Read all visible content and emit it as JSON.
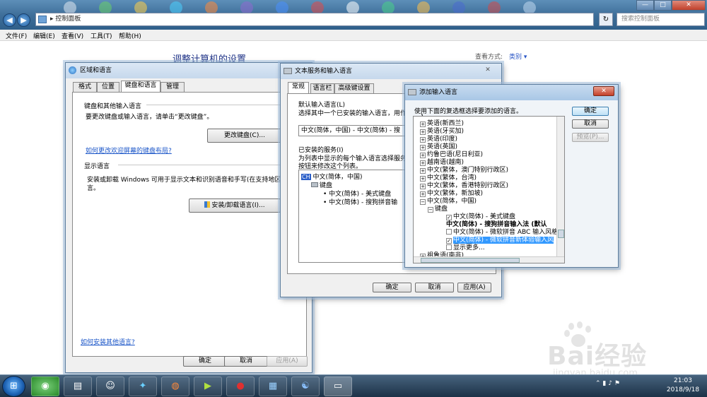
{
  "window": {
    "address": "控制面板",
    "address_sep": "▸",
    "search_placeholder": "搜索控制面板",
    "nav_back": "◀",
    "nav_forward": "▶",
    "refresh": "↻",
    "minimize": "—",
    "maximize": "□",
    "close": "✕"
  },
  "menu": {
    "file": "文件(F)",
    "edit": "编辑(E)",
    "view": "查看(V)",
    "tools": "工具(T)",
    "help": "帮助(H)"
  },
  "controlpanel": {
    "title": "调整计算机的设置",
    "view_by_label": "查看方式:",
    "view_by_value": "类别 ▾"
  },
  "region_dialog": {
    "title": "区域和语言",
    "tabs": [
      "格式",
      "位置",
      "键盘和语言",
      "管理"
    ],
    "kb_group": "键盘和其他输入语言",
    "kb_desc": "要更改键盘或输入语言，请单击“更改键盘”。",
    "change_kb_btn": "更改键盘(C)...",
    "kb_link": "如何更改欢迎屏幕的键盘布局?",
    "display_group": "显示语言",
    "display_desc_1": "安装或卸载 Windows 可用于显示文本和识别语音和手写(在支持地区)的语",
    "display_desc_2": "言。",
    "install_btn": "安装/卸载语言(I)...",
    "more_link": "如何安装其他语言?",
    "ok": "确定",
    "cancel": "取消",
    "apply": "应用(A)"
  },
  "text_services_dialog": {
    "title": "文本服务和输入语言",
    "close": "✕",
    "tabs": [
      "常规",
      "语言栏",
      "高级键设置"
    ],
    "default_group": "默认输入语言(L)",
    "default_desc": "选择其中一个已安装的输入语言，用作",
    "default_value": "中文(简体，中国) - 中文(简体) - 搜",
    "installed_group": "已安装的服务(I)",
    "installed_desc_1": "为列表中显示的每个输入语言选择服务",
    "installed_desc_2": "按钮来修改这个列表。",
    "tree": {
      "lang_code": "CH",
      "lang": "中文(简体，中国)",
      "keyboard": "键盘",
      "item1": "• 中文(简体) - 美式键盘",
      "item2": "• 中文(简体) - 搜狗拼音输"
    },
    "ok": "确定",
    "cancel": "取消",
    "apply": "应用(A)"
  },
  "add_lang_dialog": {
    "title": "添加输入语言",
    "close": "✕",
    "instruction": "使用下面的复选框选择要添加的语言。",
    "ok": "确定",
    "cancel": "取消",
    "preview": "预览(P)...",
    "languages": [
      "英语(新西兰)",
      "英语(牙买加)",
      "英语(印度)",
      "英语(英国)",
      "约鲁巴语(尼日利亚)",
      "越南语(越南)",
      "中文(繁体，澳门特别行政区)",
      "中文(繁体，台湾)",
      "中文(繁体，香港特别行政区)",
      "中文(繁体，新加坡)",
      "中文(简体，中国)"
    ],
    "keyboard_node": "键盘",
    "kb_items": [
      "中文(简体) - 美式键盘",
      "中文(简体) - 搜狗拼音输入法 (默认",
      "中文(简体) - 微软拼音 ABC 输入风格",
      "中文(简体) - 微软拼音新体验输入风"
    ],
    "show_more": "显示更多...",
    "last_lang": "祖鲁语(南非)"
  },
  "taskbar": {
    "start": "⊞",
    "icons": [
      "◉",
      "▤",
      "☺",
      "✦",
      "◍",
      "▶",
      "●",
      "▦",
      "☯",
      "▭"
    ],
    "time": "21:03",
    "date": "2018/9/18",
    "tray": "⌃ ▮ ♪ ⚑"
  },
  "watermark": {
    "brand": "Bai经验",
    "url": "jingyan.baidu.com"
  }
}
